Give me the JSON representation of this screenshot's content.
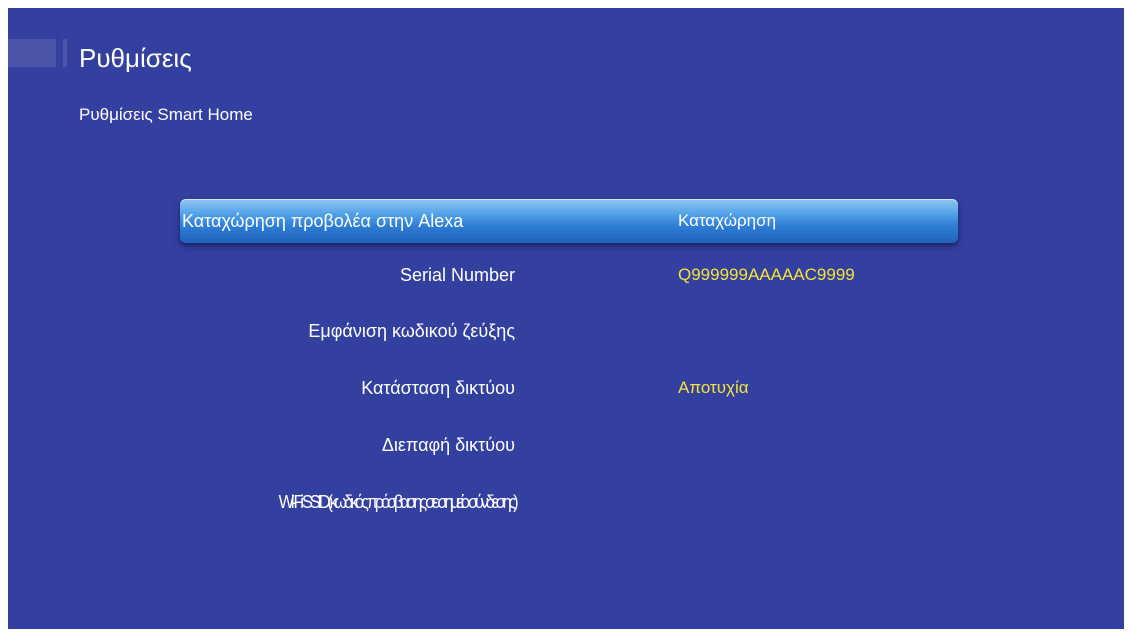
{
  "header": {
    "title": "Ρυθμίσεις",
    "subtitle": "Ρυθμίσεις Smart Home"
  },
  "colors": {
    "background": "#3440a0",
    "value_text": "#f5e23a",
    "highlight": "#2f7fd6"
  },
  "settings": [
    {
      "label": "Καταχώρηση προβολέα στην Alexa",
      "value": "Καταχώρηση",
      "selected": true
    },
    {
      "label": "Serial Number",
      "value": "Q999999AAAAAC9999"
    },
    {
      "label": "Εμφάνιση κωδικού ζεύξης",
      "value": ""
    },
    {
      "label": "Κατάσταση δικτύου",
      "value": "Αποτυχία"
    },
    {
      "label": "Διεπαφή δικτύου",
      "value": ""
    },
    {
      "label": "Wi-Fi SSID(κωδικός πρόσβασης σε σημείο σύνδεσης)",
      "value": ""
    }
  ]
}
